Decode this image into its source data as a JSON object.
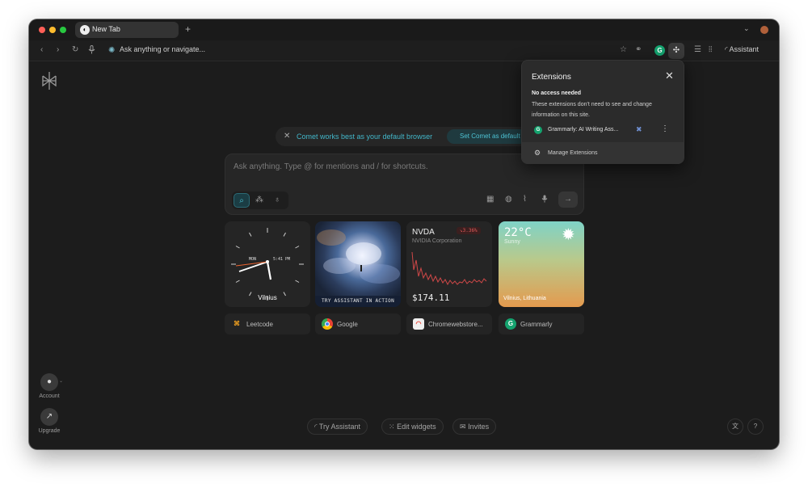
{
  "tab": {
    "label": "New Tab"
  },
  "toolbar": {
    "omnibox_placeholder": "Ask anything or navigate...",
    "assistant_label": "Assistant"
  },
  "sidebar": {
    "account_label": "Account",
    "upgrade_label": "Upgrade"
  },
  "banner": {
    "text": "Comet works best as your default browser",
    "cta": "Set Comet as default"
  },
  "search": {
    "placeholder": "Ask anything. Type @ for mentions and / for shortcuts."
  },
  "widgets": {
    "clock": {
      "city": "Vilnius",
      "day": "MON",
      "time": "5:41 PM"
    },
    "photo": {
      "caption": "TRY ASSISTANT IN ACTION"
    },
    "stock": {
      "symbol": "NVDA",
      "name": "NVIDIA Corporation",
      "change": "↘3.36%",
      "price": "$174.11",
      "trend_color": "#d04848"
    },
    "weather": {
      "temp": "22°C",
      "condition": "Sunny",
      "city": "Vilnius, Lithuania"
    }
  },
  "shortcuts": [
    {
      "label": "Leetcode",
      "icon": "leetcode-icon"
    },
    {
      "label": "Google",
      "icon": "chrome-icon"
    },
    {
      "label": "Chromewebstore...",
      "icon": "webstore-icon"
    },
    {
      "label": "Grammarly",
      "icon": "grammarly-icon"
    }
  ],
  "bottom": {
    "try_assistant": "Try Assistant",
    "edit_widgets": "Edit widgets",
    "invites": "Invites"
  },
  "extensions_popup": {
    "title": "Extensions",
    "heading": "No access needed",
    "description": "These extensions don't need to see and change information on this site.",
    "extension_name": "Grammarly: AI Writing Ass...",
    "manage_label": "Manage Extensions"
  },
  "colors": {
    "accent": "#42b6c9",
    "grammarly": "#15a36f",
    "background": "#1c1c1c"
  }
}
